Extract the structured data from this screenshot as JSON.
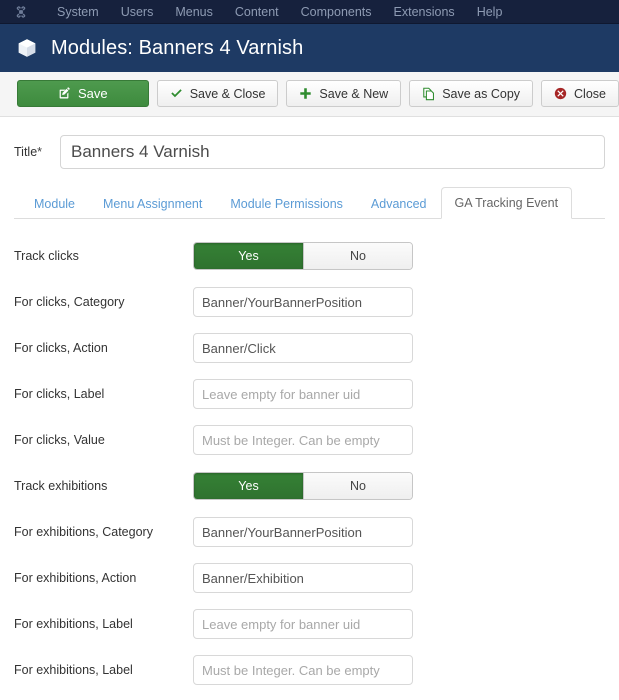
{
  "admin_nav": {
    "logo_icon": "joomla-logo-icon",
    "items": [
      {
        "label": "System"
      },
      {
        "label": "Users"
      },
      {
        "label": "Menus"
      },
      {
        "label": "Content"
      },
      {
        "label": "Components"
      },
      {
        "label": "Extensions"
      },
      {
        "label": "Help"
      }
    ]
  },
  "header": {
    "icon": "cube-box-icon",
    "title": "Modules: Banners 4 Varnish",
    "bg_color": "#1e3a64"
  },
  "toolbar": {
    "buttons": [
      {
        "label": "Save",
        "icon": "edit-pencil-square-icon",
        "style": "primary-green"
      },
      {
        "label": "Save & Close",
        "icon": "check-icon",
        "style": "default"
      },
      {
        "label": "Save & New",
        "icon": "plus-icon",
        "style": "default"
      },
      {
        "label": "Save as Copy",
        "icon": "copy-pages-icon",
        "style": "default"
      },
      {
        "label": "Close",
        "icon": "close-circle-icon",
        "style": "default"
      }
    ]
  },
  "title_field": {
    "label": "Title",
    "required_marker": "*",
    "value": "Banners 4 Varnish",
    "placeholder": ""
  },
  "tabs": [
    {
      "label": "Module",
      "active": false
    },
    {
      "label": "Menu Assignment",
      "active": false
    },
    {
      "label": "Module Permissions",
      "active": false
    },
    {
      "label": "Advanced",
      "active": false
    },
    {
      "label": "GA Tracking Event",
      "active": true
    }
  ],
  "form": {
    "rows": [
      {
        "label": "Track clicks",
        "type": "toggle",
        "yes_label": "Yes",
        "no_label": "No",
        "selected": "Yes"
      },
      {
        "label": "For clicks, Category",
        "type": "text",
        "value": "Banner/YourBannerPosition",
        "placeholder": ""
      },
      {
        "label": "For clicks, Action",
        "type": "text",
        "value": "Banner/Click",
        "placeholder": ""
      },
      {
        "label": "For clicks, Label",
        "type": "text",
        "value": "",
        "placeholder": "Leave empty for banner uid"
      },
      {
        "label": "For clicks, Value",
        "type": "text",
        "value": "",
        "placeholder": "Must be Integer. Can be empty"
      },
      {
        "label": "Track exhibitions",
        "type": "toggle",
        "yes_label": "Yes",
        "no_label": "No",
        "selected": "Yes"
      },
      {
        "label": "For exhibitions, Category",
        "type": "text",
        "value": "Banner/YourBannerPosition",
        "placeholder": ""
      },
      {
        "label": "For exhibitions, Action",
        "type": "text",
        "value": "Banner/Exhibition",
        "placeholder": ""
      },
      {
        "label": "For exhibitions, Label",
        "type": "text",
        "value": "",
        "placeholder": "Leave empty for banner uid"
      },
      {
        "label": "For exhibitions, Label",
        "type": "text",
        "value": "",
        "placeholder": "Must be Integer. Can be empty"
      }
    ]
  },
  "colors": {
    "nav_bg": "#16213d",
    "header_bg": "#1e3a64",
    "toolbar_bg": "#f5f5f5",
    "accent_green": "#358135",
    "tab_link": "#5b9bd5",
    "close_red": "#b02b2b"
  }
}
